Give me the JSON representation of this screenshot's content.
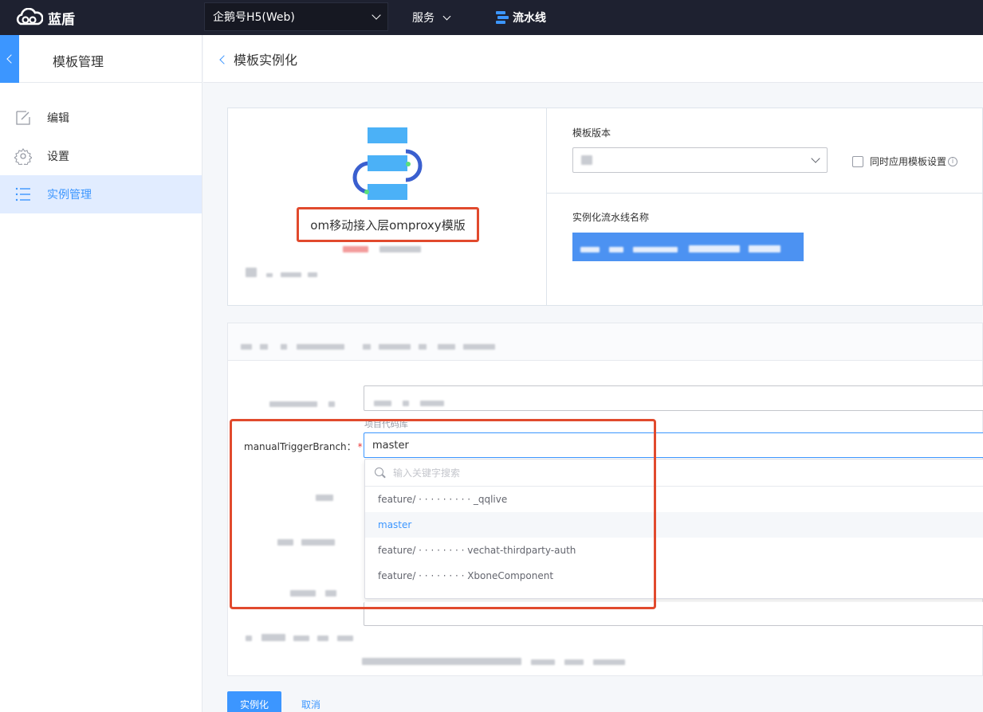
{
  "topbar": {
    "brand": "蓝盾",
    "project": "企鹅号H5(Web)",
    "service_menu": "服务",
    "pipeline_nav": "流水线"
  },
  "sidebar": {
    "title": "模板管理",
    "items": [
      {
        "label": "编辑",
        "icon": "edit-icon"
      },
      {
        "label": "设置",
        "icon": "gear-icon"
      },
      {
        "label": "实例管理",
        "icon": "list-icon"
      }
    ],
    "active_index": 2
  },
  "page": {
    "title": "模板实例化"
  },
  "template": {
    "name": "om移动接入层omproxy模版",
    "version_label": "模板版本",
    "apply_settings_label": "同时应用模板设置",
    "instance_name_label": "实例化流水线名称"
  },
  "params": {
    "branch_label": "manualTriggerBranch：",
    "required_mark": "*",
    "branch_hint": "项目代码库",
    "branch_value": "master",
    "search_placeholder": "输入关键字搜索",
    "options": [
      "feature/ ·  ·  ·  ·  ·  ·  ·  ·  ·  _qqlive",
      "master",
      "feature/ ·  ·  ·  ·  ·  ·  ·  ·  vechat-thirdparty-auth",
      "feature/ ·  ·  ·  ·  ·  ·  ·  ·  XboneComponent"
    ],
    "selected_option_index": 1
  },
  "actions": {
    "submit": "实例化",
    "cancel": "取消"
  },
  "colors": {
    "accent": "#3c96ff",
    "topbar": "#1e2130",
    "highlight_frame": "#e14a2d"
  }
}
